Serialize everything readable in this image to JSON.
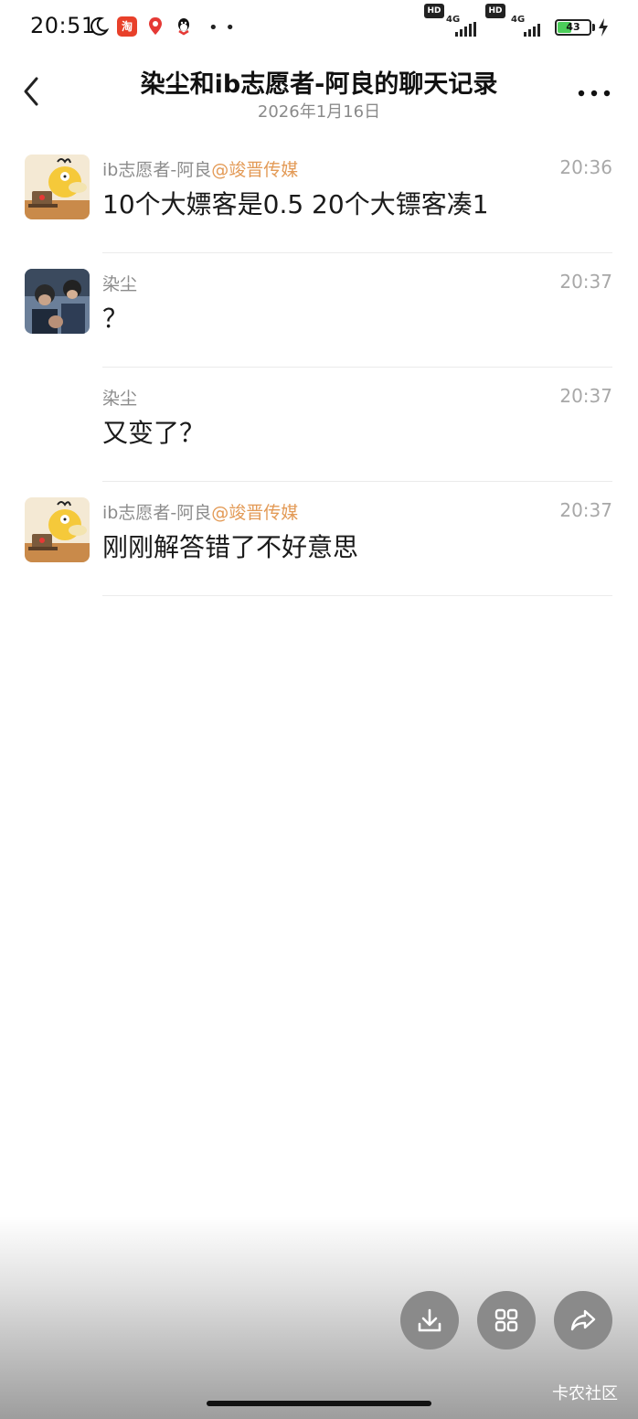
{
  "status_bar": {
    "time": "20:51",
    "app_badge": "淘",
    "network_1": "4G",
    "network_2": "4G",
    "hd": "HD",
    "battery_level": "43",
    "battery_fraction": 0.43,
    "icons": [
      "moon-icon",
      "taobao-app-icon",
      "map-pin-icon",
      "qq-icon",
      "more-dots-icon",
      "signal-icon",
      "battery-icon",
      "charging-icon"
    ]
  },
  "header": {
    "title": "染尘和ib志愿者-阿良的聊天记录",
    "date": "2026年1月16日"
  },
  "messages": [
    {
      "sender": "ib志愿者-阿良",
      "sender_tag": "@竣晋传媒",
      "time": "20:36",
      "text": "10个大嫖客是0.5  20个大镖客凑1",
      "avatar": "duck-avatar"
    },
    {
      "sender": "染尘",
      "sender_tag": "",
      "time": "20:37",
      "text": "？",
      "avatar": "photo-avatar"
    },
    {
      "sender": "染尘",
      "sender_tag": "",
      "time": "20:37",
      "text": "又变了？",
      "avatar": ""
    },
    {
      "sender": "ib志愿者-阿良",
      "sender_tag": "@竣晋传媒",
      "time": "20:37",
      "text": "刚刚解答错了不好意思",
      "avatar": "duck-avatar"
    }
  ],
  "actions": {
    "icons": [
      "download-icon",
      "grid-icon",
      "share-icon"
    ]
  },
  "watermark": "卡农社区",
  "colors": {
    "accent_tag": "#e39a56",
    "text_primary": "#1a1a1a",
    "text_secondary": "#8c8c8c",
    "fab_bg": "#8a8a8a"
  }
}
